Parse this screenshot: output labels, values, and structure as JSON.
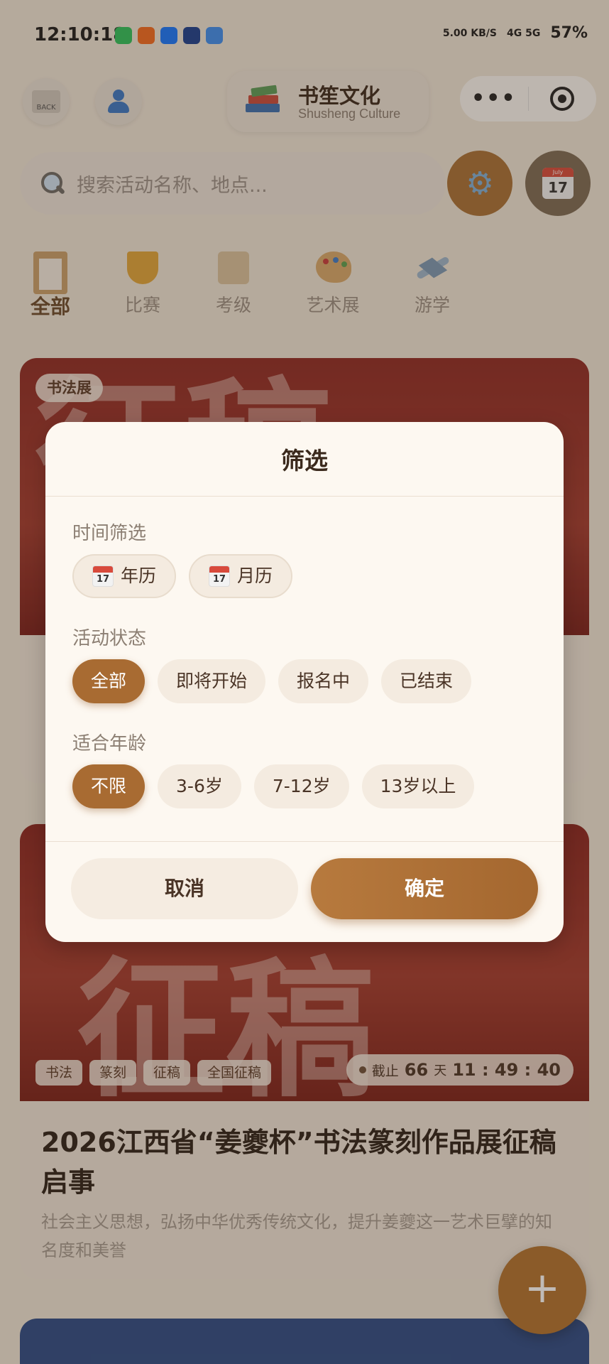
{
  "status_bar": {
    "time": "12:10:18",
    "speed": "5.00 KB/S",
    "network": "4G 5G",
    "battery": "57%"
  },
  "header": {
    "back_label": "BACK",
    "brand_title": "书笙文化",
    "brand_subtitle": "Shusheng Culture",
    "capsule_menu": "•••"
  },
  "search": {
    "placeholder": "搜索活动名称、地点...",
    "calendar_month": "July",
    "calendar_day": "17"
  },
  "categories": [
    {
      "label": "全部",
      "icon": "clipboard-icon",
      "active": true
    },
    {
      "label": "比赛",
      "icon": "trophy-icon"
    },
    {
      "label": "考级",
      "icon": "scroll-icon"
    },
    {
      "label": "艺术展",
      "icon": "palette-icon"
    },
    {
      "label": "游学",
      "icon": "airplane-icon"
    }
  ],
  "cards": [
    {
      "tag": "书法展",
      "banner_text": "征稿"
    },
    {
      "banner_text": "征稿",
      "tags": [
        "书法",
        "篆刻",
        "征稿",
        "全国征稿"
      ],
      "deadline": {
        "label": "截止",
        "days": "66",
        "days_unit": "天",
        "time": "11 : 49 : 40"
      },
      "title": "2026江西省“姜夔杯”书法篆刻作品展征稿启事",
      "desc": "社会主义思想，弘扬中华优秀传统文化，提升姜夔这一艺术巨擘的知名度和美誉"
    }
  ],
  "fab": {
    "label": "+"
  },
  "modal": {
    "title": "筛选",
    "time_section": {
      "label": "时间筛选",
      "options": [
        {
          "label": "年历",
          "icon": "calendar-icon"
        },
        {
          "label": "月历",
          "icon": "calendar-icon"
        }
      ]
    },
    "status_section": {
      "label": "活动状态",
      "options": [
        "全部",
        "即将开始",
        "报名中",
        "已结束"
      ],
      "selected": "全部"
    },
    "age_section": {
      "label": "适合年龄",
      "options": [
        "不限",
        "3-6岁",
        "7-12岁",
        "13岁以上"
      ],
      "selected": "不限"
    },
    "cancel_label": "取消",
    "confirm_label": "确定"
  },
  "colors": {
    "accent": "#a86b32",
    "background": "#efe6d8",
    "text_dark": "#3b2a1d"
  }
}
